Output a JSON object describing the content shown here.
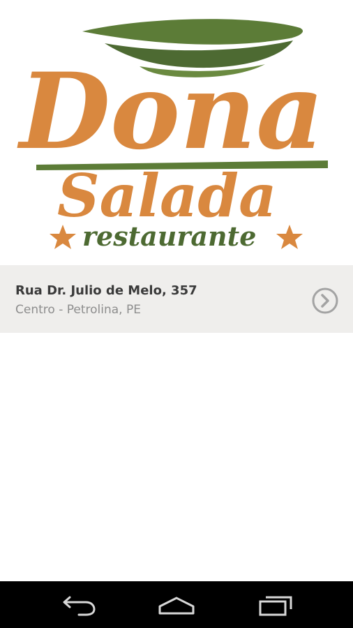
{
  "app": {
    "logo": {
      "line1": "Dona",
      "line2": "Salada",
      "line3": "restaurante"
    }
  },
  "colors": {
    "brand_orange": "#d9883f",
    "brand_green": "#4d6a32",
    "row_background": "#efeeec",
    "nav_background": "#000000"
  },
  "location": {
    "street": "Rua Dr. Julio de Melo, 357",
    "city": "Centro - Petrolina, PE",
    "action_icon": "chevron-right-circle-icon"
  },
  "navigation": {
    "back_icon": "back-icon",
    "home_icon": "home-icon",
    "recents_icon": "recents-icon"
  }
}
